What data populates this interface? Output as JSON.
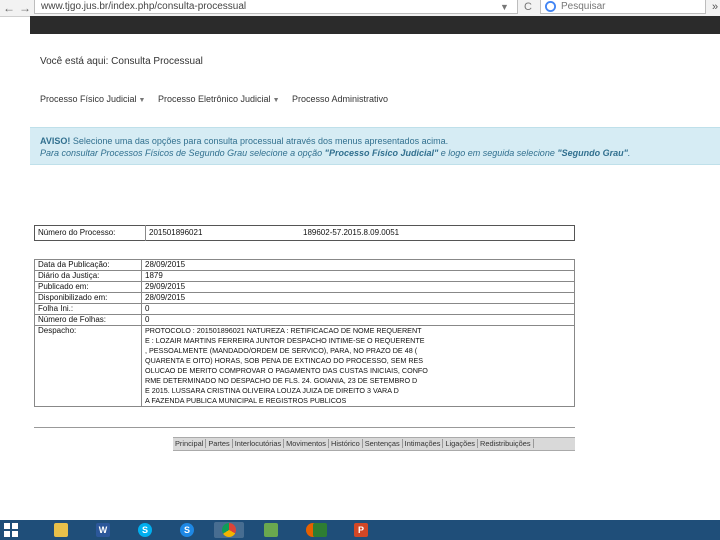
{
  "browser": {
    "url": "www.tjgo.jus.br/index.php/consulta-processual",
    "search_placeholder": "Pesquisar",
    "url_dropdown": "▼",
    "reload": "C",
    "back": "←",
    "forward": "→",
    "menu": "»"
  },
  "breadcrumb": "Você está aqui: Consulta Processual",
  "menu": {
    "items": [
      {
        "label": "Processo Físico Judicial"
      },
      {
        "label": "Processo Eletrônico Judicial"
      },
      {
        "label": "Processo Administrativo"
      }
    ]
  },
  "notice": {
    "prefix": "AVISO!",
    "line1": "Selecione uma das opções para consulta processual através dos menus apresentados acima.",
    "line2_a": "Para consultar Processos Físicos de Segundo Grau selecione a opção ",
    "line2_b": "\"Processo Físico Judicial\"",
    "line2_c": " e logo em seguida selecione ",
    "line2_d": "\"Segundo Grau\"",
    "line2_e": "."
  },
  "processo": {
    "label": "Número do Processo:",
    "numero": "201501896021",
    "numero_cnj": "189602-57.2015.8.09.0051"
  },
  "info": {
    "rows": [
      {
        "label": "Data da Publicação:",
        "value": "28/09/2015"
      },
      {
        "label": "Diário da Justiça:",
        "value": "1879"
      },
      {
        "label": "Publicado em:",
        "value": "29/09/2015"
      },
      {
        "label": "Disponibilizado em:",
        "value": "28/09/2015"
      },
      {
        "label": "Folha Ini.:",
        "value": "0"
      },
      {
        "label": "Número de Folhas:",
        "value": "0"
      }
    ],
    "despacho_label": "Despacho:",
    "despacho_lines": [
      "PROTOCOLO : 201501896021 NATUREZA : RETIFICACAO DE NOME REQUERENT",
      "E : LOZAIR MARTINS FERREIRA JUNTOR DESPACHO INTIME-SE O REQUERENTE",
      ", PESSOALMENTE (MANDADO/ORDEM DE SERVICO), PARA, NO PRAZO DE 48 (",
      "QUARENTA E OITO) HORAS, SOB PENA DE EXTINCAO DO PROCESSO, SEM RES",
      "OLUCAO DE MERITO COMPROVAR O PAGAMENTO DAS CUSTAS INICIAIS, CONFO",
      "RME DETERMINADO NO DESPACHO DE FLS. 24. GOIANIA, 23 DE SETEMBRO D",
      "E 2015. LUSSARA CRISTINA OLIVEIRA LOUZA JUIZA DE DIREITO 3 VARA D",
      "A FAZENDA PUBLICA MUNICIPAL E REGISTROS PUBLICOS"
    ]
  },
  "tabs": [
    "Principal",
    "Partes",
    "Interlocutórias",
    "Movimentos",
    "Histórico",
    "Sentenças",
    "Intimações",
    "Ligações",
    "Redistribuições"
  ],
  "taskbar": {
    "icons": [
      {
        "name": "file-explorer-icon",
        "glyph": "",
        "color": "#e8c04a"
      },
      {
        "name": "word-icon",
        "glyph": "W",
        "color": "#2b579a"
      },
      {
        "name": "skype-icon",
        "glyph": "S",
        "color": "#00aff0"
      },
      {
        "name": "skype-business-icon",
        "glyph": "S",
        "color": "#1e88e5"
      },
      {
        "name": "chrome-icon",
        "glyph": "",
        "color": "#db4437"
      },
      {
        "name": "paint-icon",
        "glyph": "",
        "color": "#6aa84f"
      },
      {
        "name": "firefox-icon",
        "glyph": "",
        "color": "#e66000"
      },
      {
        "name": "calculator-icon",
        "glyph": "",
        "color": "#2e7d32"
      },
      {
        "name": "powerpoint-icon",
        "glyph": "P",
        "color": "#d24726"
      }
    ]
  }
}
